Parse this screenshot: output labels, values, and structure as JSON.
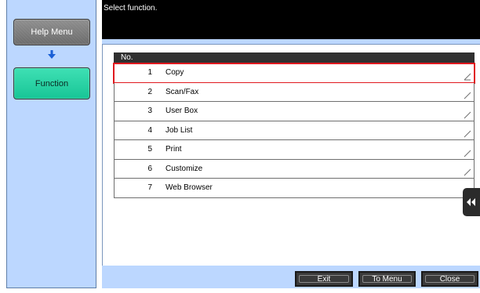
{
  "sidebar": {
    "help_menu_label": "Help Menu",
    "function_label": "Function"
  },
  "header": {
    "prompt": "Select function."
  },
  "table": {
    "column_header": "No.",
    "rows": [
      {
        "num": "1",
        "label": "Copy"
      },
      {
        "num": "2",
        "label": "Scan/Fax"
      },
      {
        "num": "3",
        "label": "User Box"
      },
      {
        "num": "4",
        "label": "Job List"
      },
      {
        "num": "5",
        "label": "Print"
      },
      {
        "num": "6",
        "label": "Customize"
      },
      {
        "num": "7",
        "label": "Web Browser"
      }
    ]
  },
  "footer": {
    "exit_label": "Exit",
    "to_menu_label": "To Menu",
    "close_label": "Close"
  },
  "colors": {
    "panel_blue": "#bcd7ff",
    "function_green": "#1fd3a3",
    "highlight_red": "#e0191f",
    "header_black": "#000000"
  },
  "icons": {
    "down_arrow": "arrow-down-icon",
    "handle": "double-chevron-left-icon",
    "row_corner": "row-corner-icon"
  }
}
